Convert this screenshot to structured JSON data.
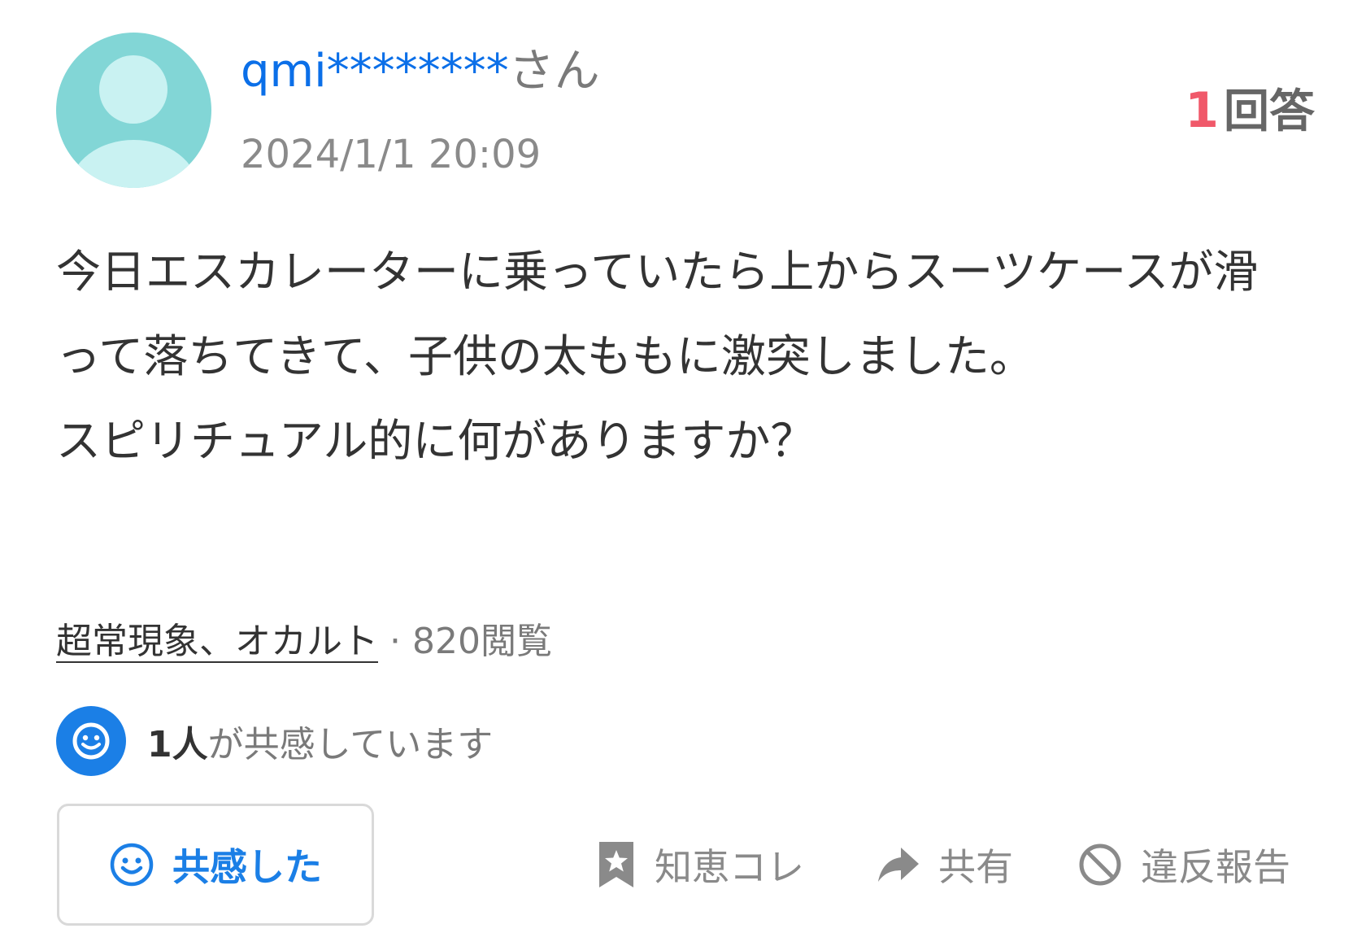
{
  "header": {
    "username": "qmi********",
    "honorific": "さん",
    "date": "2024/1/1 20:09",
    "answer_count": "1",
    "answer_label": "回答"
  },
  "question": {
    "body": "今日エスカレーターに乗っていたら上からスーツケースが滑って落ちてきて、子供の太ももに激突しました。\nスピリチュアル的に何がありますか？"
  },
  "meta": {
    "category": "超常現象、オカルト",
    "views": " · 820閲覧"
  },
  "empathy": {
    "count": "1人",
    "text": "が共感しています"
  },
  "actions": {
    "empathize_label": "共感した",
    "bookmark_label": "知恵コレ",
    "share_label": "共有",
    "report_label": "違反報告"
  },
  "icons": {
    "avatar": "default-user-avatar-icon",
    "smile": "smile-icon",
    "bookmark": "bookmark-star-icon",
    "share": "share-arrow-icon",
    "report": "prohibited-icon"
  },
  "colors": {
    "username": "#0b6fe8",
    "answer_count": "#f0596a",
    "accent": "#1b7fe6",
    "avatar_bg": "#82d6d6"
  }
}
